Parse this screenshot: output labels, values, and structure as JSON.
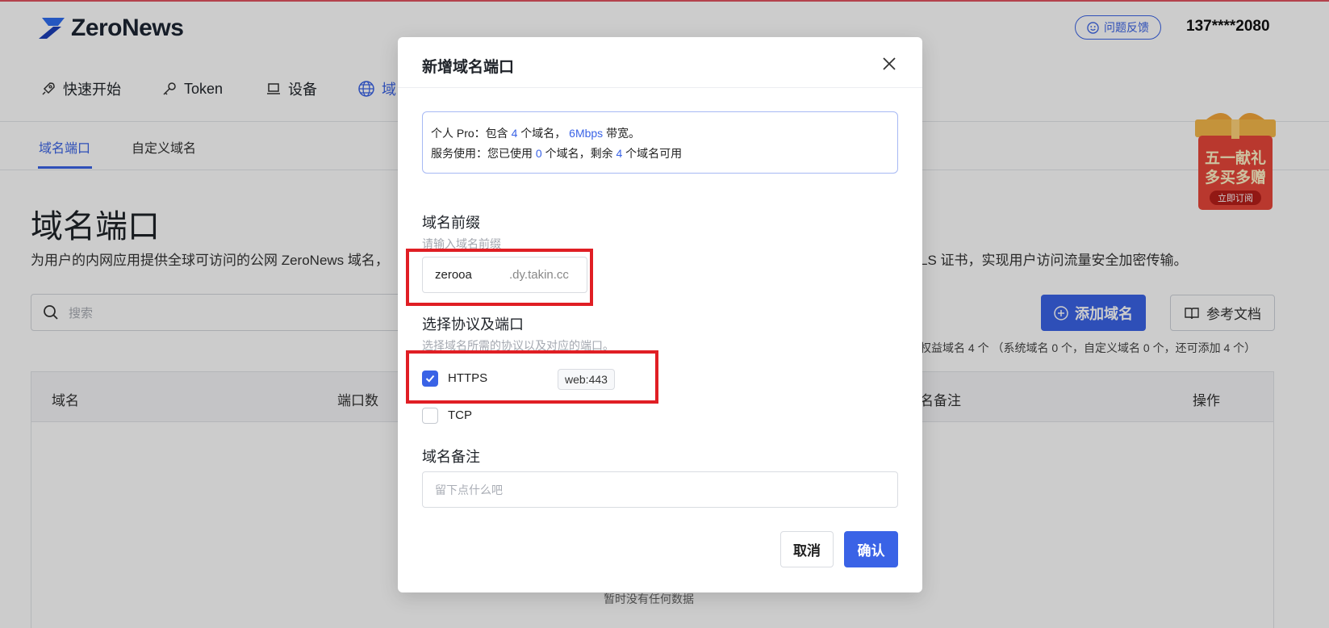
{
  "header": {
    "logo_text": "ZeroNews",
    "feedback_label": "问题反馈",
    "user_phone": "137****2080"
  },
  "nav": {
    "items": [
      {
        "label": "快速开始",
        "icon": "rocket-icon"
      },
      {
        "label": "Token",
        "icon": "key-icon"
      },
      {
        "label": "设备",
        "icon": "laptop-icon"
      },
      {
        "label": "域",
        "icon": "globe-icon",
        "active": true
      }
    ]
  },
  "subtabs": {
    "domain_port": "域名端口",
    "custom_domain": "自定义域名"
  },
  "page": {
    "title": "域名端口",
    "desc_left": "为用户的内网应用提供全球可访问的公网 ZeroNews 域名，",
    "desc_right": "LS 证书，实现用户访问流量安全加密传输。",
    "search_placeholder": "搜索",
    "add_domain_label": "添加域名",
    "docs_label": "参考文档",
    "quota_text": "权益域名 4 个 （系统域名 0 个，自定义域名 0 个，还可添加 4 个）",
    "empty_text": "暂时没有任何数据"
  },
  "table": {
    "headers": {
      "domain": "域名",
      "ports": "端口数",
      "remark": "名备注",
      "action": "操作"
    }
  },
  "promo": {
    "line1": "五一献礼",
    "line2": "多买多赠",
    "button": "立即订阅"
  },
  "modal": {
    "title": "新增域名端口",
    "info": {
      "plan_prefix": "个人 Pro：包含 ",
      "plan_domains": "4",
      "plan_mid": " 个域名，",
      "plan_bandwidth": "6Mbps",
      "plan_suffix": " 带宽。",
      "usage_prefix": "服务使用：您已使用 ",
      "usage_used": "0",
      "usage_mid": " 个域名，剩余 ",
      "usage_left": "4",
      "usage_suffix": " 个域名可用"
    },
    "prefix_label": "域名前缀",
    "prefix_hint": "请输入域名前缀",
    "prefix_value": "zerooa",
    "prefix_suffix": ".dy.takin.cc",
    "protocol_label": "选择协议及端口",
    "protocol_hint": "选择域名所需的协议以及对应的端口。",
    "protocols": [
      {
        "name": "HTTPS",
        "checked": true,
        "port": "web:443"
      },
      {
        "name": "TCP",
        "checked": false
      }
    ],
    "remark_label": "域名备注",
    "remark_placeholder": "留下点什么吧",
    "cancel_label": "取消",
    "confirm_label": "确认"
  },
  "colors": {
    "accent": "#3a63e6",
    "highlight": "#e01e24",
    "promo": "#e8473a"
  }
}
